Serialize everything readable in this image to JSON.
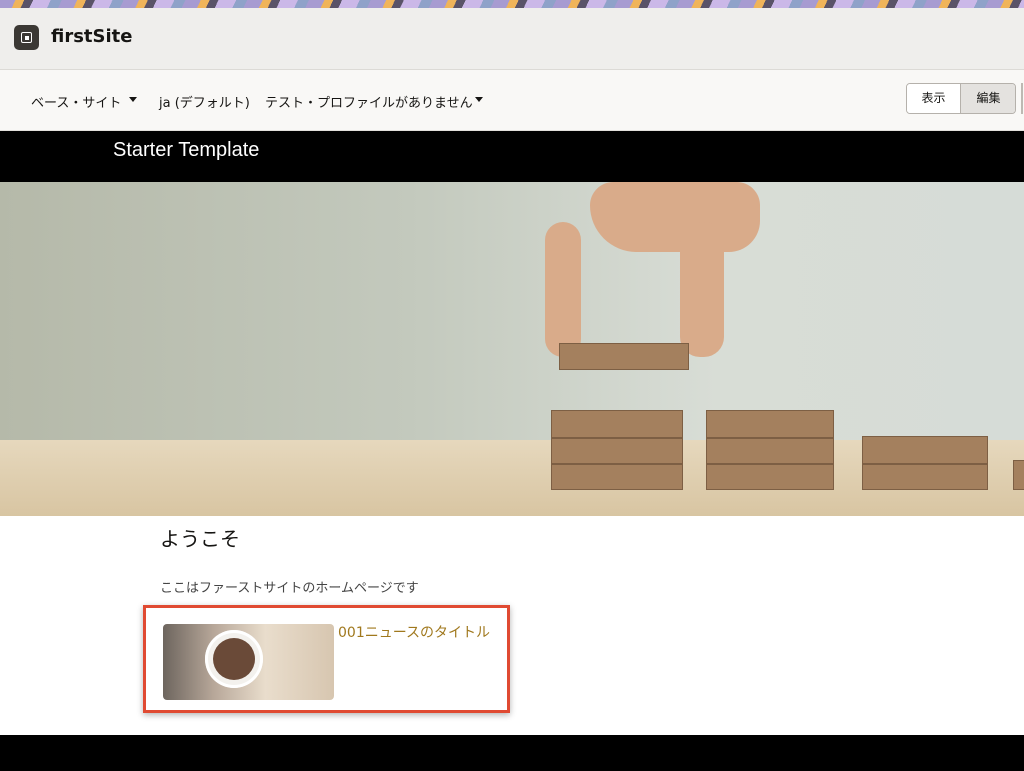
{
  "app": {
    "site_name": "firstSite"
  },
  "toolbar": {
    "base_site": "ベース・サイト",
    "language": "ja (デフォルト)",
    "test_profile": "テスト・プロファイルがありません",
    "view_label": "表示",
    "edit_label": "編集"
  },
  "page": {
    "header_title": "Starter Template",
    "welcome_heading": "ようこそ",
    "intro_text": "ここはファーストサイトのホームページです",
    "news_item": {
      "title": "001ニュースのタイトル"
    }
  },
  "colors": {
    "accent_link": "#a0781d",
    "highlight_border": "#e04a32",
    "header_bg": "#000000"
  }
}
